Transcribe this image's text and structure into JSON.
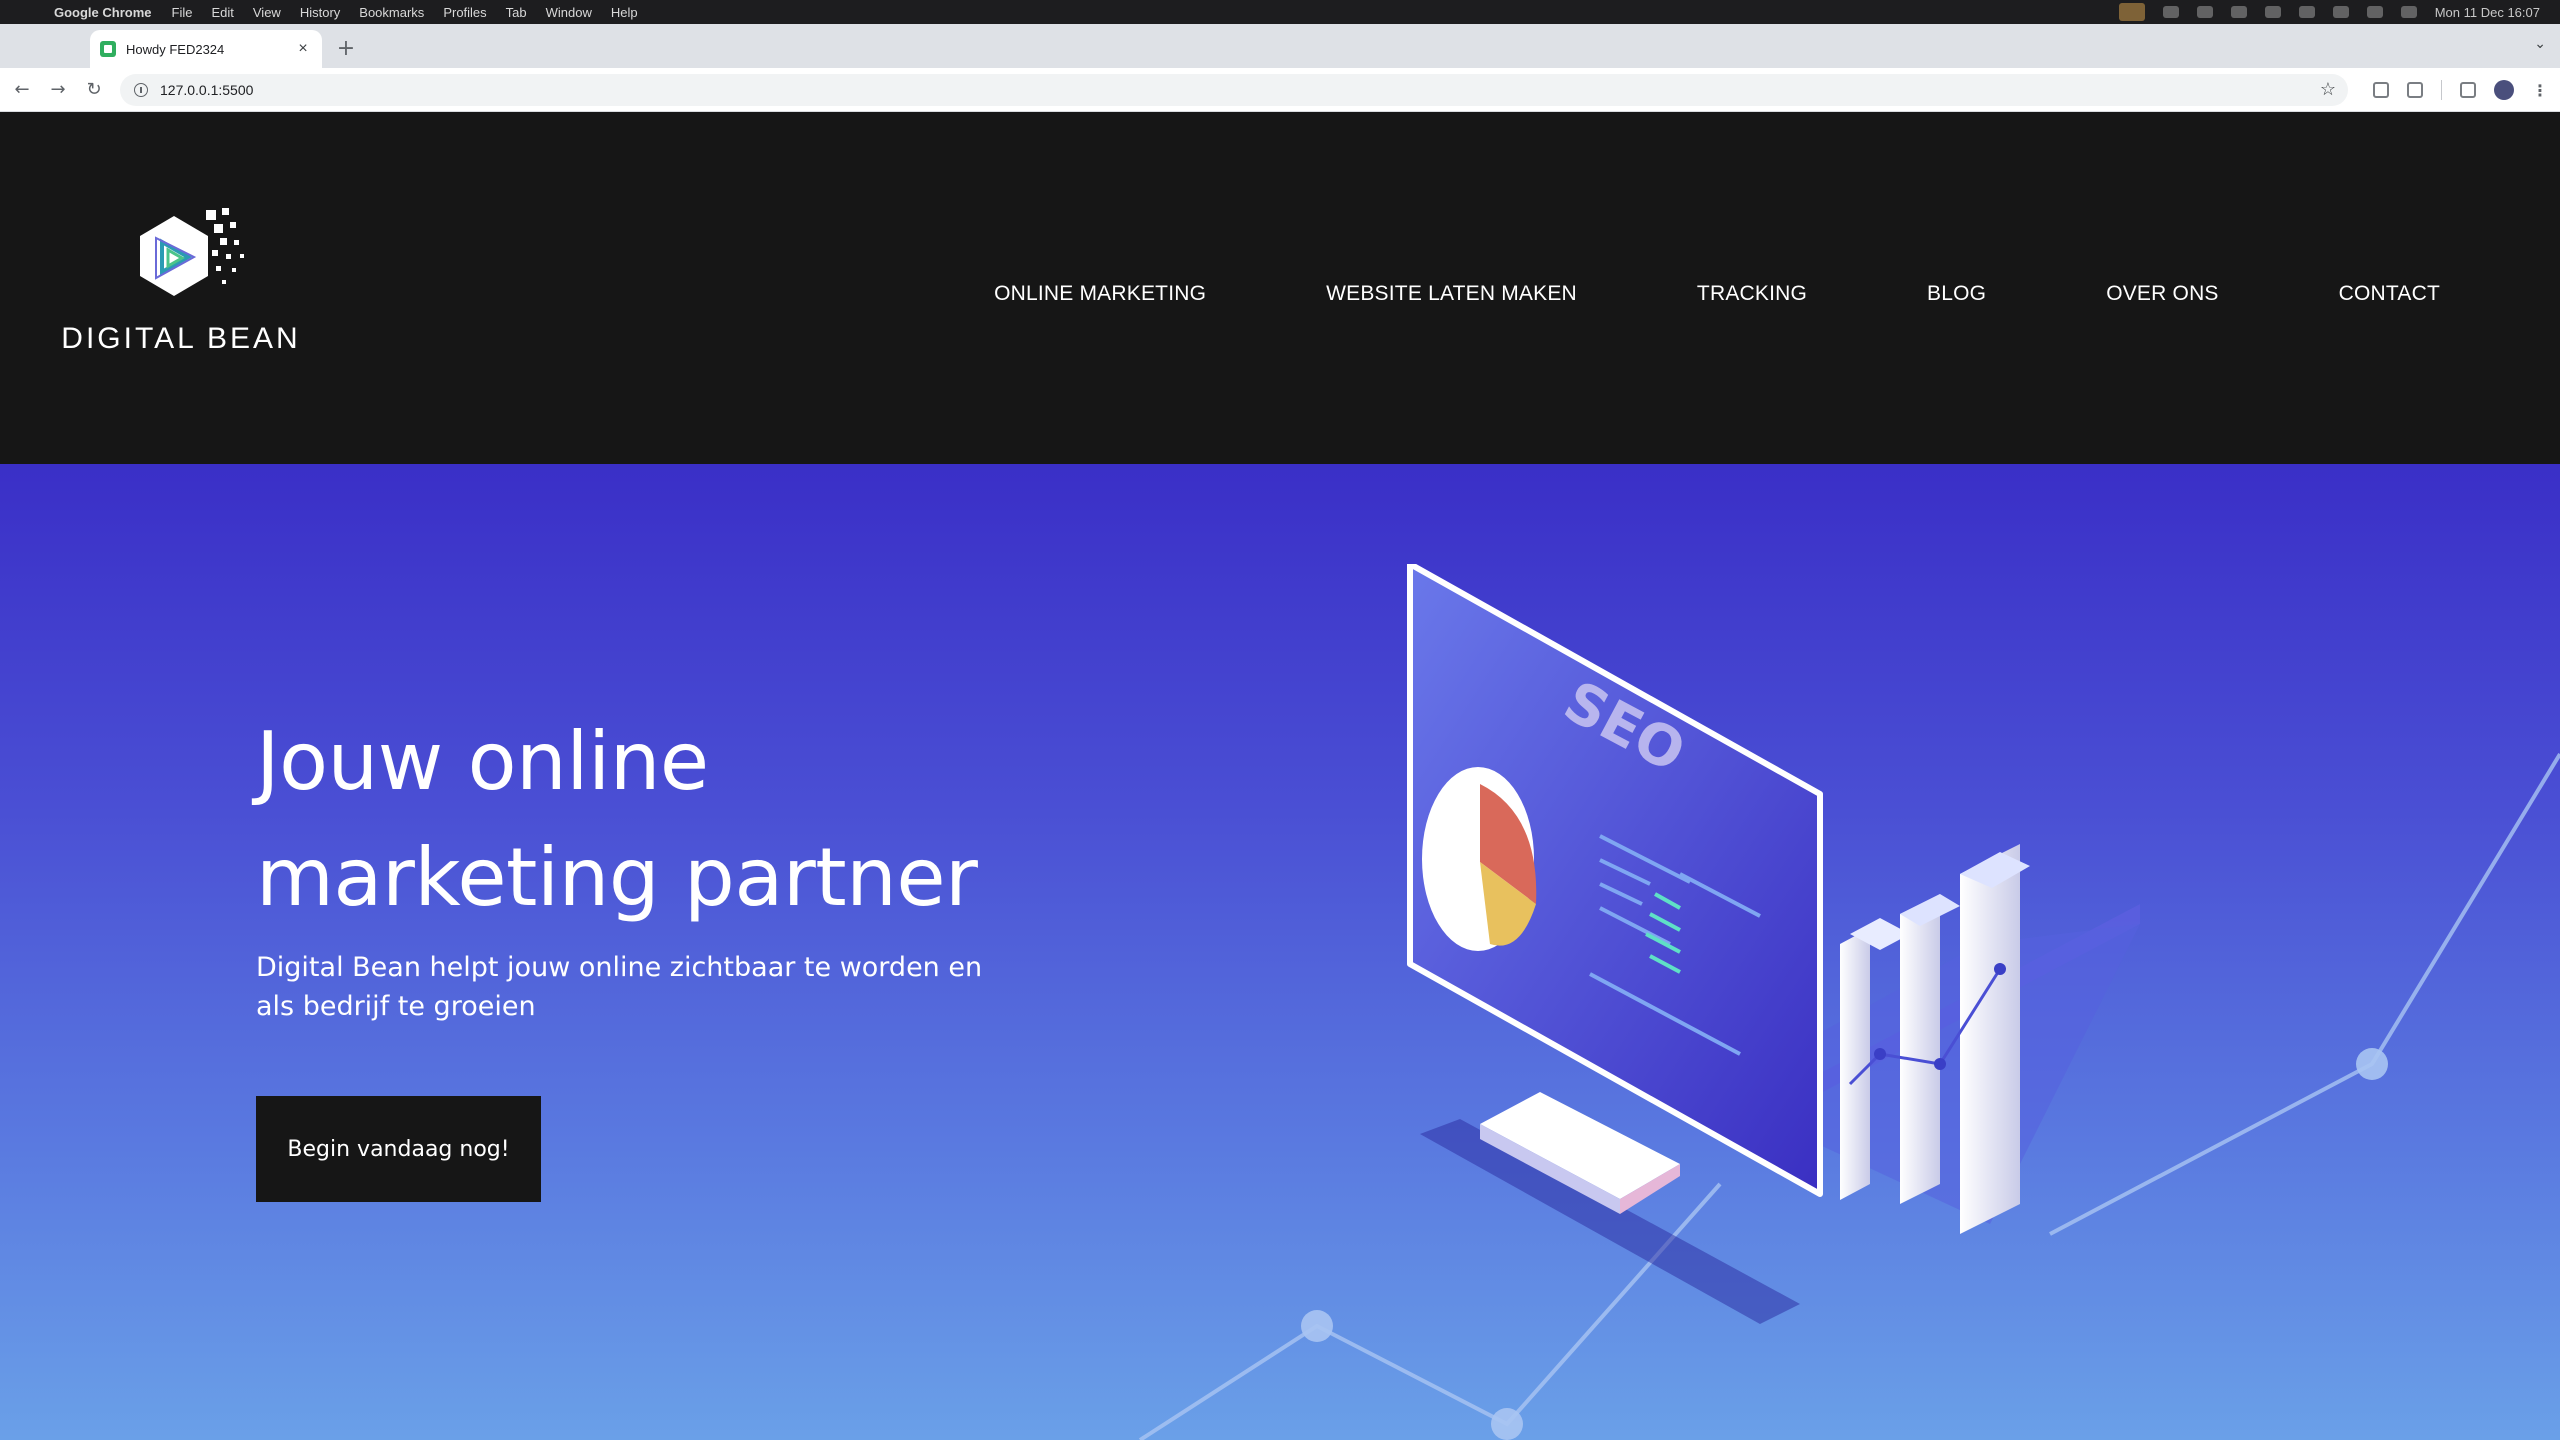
{
  "os_menubar": {
    "app_name": "Google Chrome",
    "menus": [
      "File",
      "Edit",
      "View",
      "History",
      "Bookmarks",
      "Profiles",
      "Tab",
      "Window",
      "Help"
    ],
    "clock": "Mon 11 Dec  16:07"
  },
  "browser": {
    "tab_title": "Howdy FED2324",
    "tab_close": "×",
    "new_tab": "+",
    "url": "127.0.0.1:5500"
  },
  "site": {
    "logo_text": "DIGITAL BEAN",
    "nav": [
      "ONLINE MARKETING",
      "WEBSITE LATEN MAKEN",
      "TRACKING",
      "BLOG",
      "OVER ONS",
      "CONTACT"
    ],
    "hero": {
      "title_line1": "Jouw online",
      "title_line2": "marketing partner",
      "subtitle": "Digital Bean helpt jouw online zichtbaar te worden en als bedrijf te groeien",
      "cta": "Begin vandaag nog!"
    },
    "illustration_label": "SEO"
  },
  "colors": {
    "header_bg": "#161616",
    "hero_top": "#3a2fc7",
    "hero_bottom": "#6aa0e8",
    "cta_bg": "#161616"
  },
  "icons": [
    "apple-icon",
    "info-icon",
    "star-icon",
    "extension-icon",
    "profile-icon",
    "kebab-menu-icon",
    "favicon-icon"
  ]
}
